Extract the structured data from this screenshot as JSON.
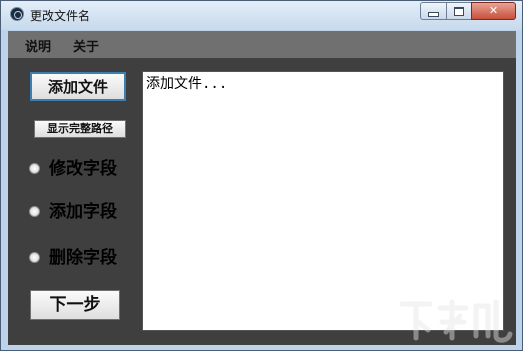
{
  "window": {
    "title": "更改文件名",
    "icons": {
      "app": "app-icon",
      "minimize": "minimize-icon",
      "maximize": "maximize-icon",
      "close": "close-icon"
    }
  },
  "menu": {
    "items": [
      {
        "label": "说明"
      },
      {
        "label": "关于"
      }
    ]
  },
  "buttons": {
    "add_file": "添加文件",
    "show_full_path": "显示完整路径",
    "next_step": "下一步"
  },
  "options": [
    {
      "label": "修改字段",
      "checked": false
    },
    {
      "label": "添加字段",
      "checked": false
    },
    {
      "label": "删除字段",
      "checked": false
    }
  ],
  "file_list": {
    "text": "添加文件..."
  },
  "colors": {
    "menubar": "#707070",
    "client": "#3f3f3f",
    "close_button": "#c7503a",
    "focus_border": "#3c7fb1"
  }
}
